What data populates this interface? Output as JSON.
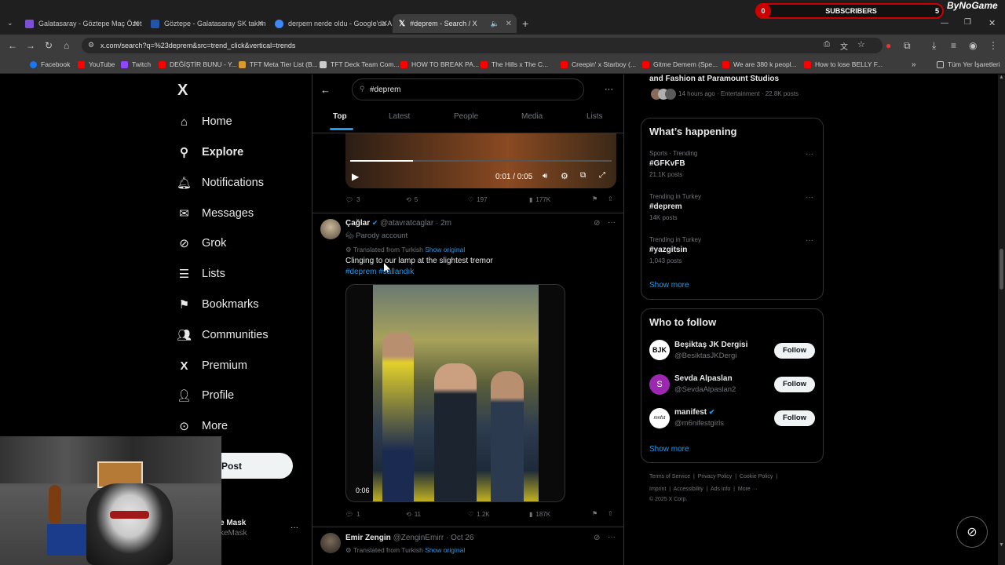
{
  "browser": {
    "tabs": [
      {
        "label": "Galatasaray - Göztepe Maç Özet",
        "favicon_color": "#7b4fd6"
      },
      {
        "label": "Göztepe - Galatasaray SK takım",
        "favicon_color": "#2255aa"
      },
      {
        "label": "derpem nerde oldu - Google'da A",
        "favicon_color": "#4285f4"
      },
      {
        "label": "#deprem - Search / X",
        "favicon_color": "#ffffff"
      }
    ],
    "url": "x.com/search?q=%23deprem&src=trend_click&vertical=trends",
    "bookmarks": [
      {
        "label": "Facebook",
        "color": "#1877f2"
      },
      {
        "label": "YouTube",
        "color": "#ff0000"
      },
      {
        "label": "Twitch",
        "color": "#9146ff"
      },
      {
        "label": "DEĞİŞTİR BUNU - Y...",
        "color": "#ff0000"
      },
      {
        "label": "TFT Meta Tier List (B...",
        "color": "#d89a2a"
      },
      {
        "label": "TFT Deck Team Com...",
        "color": "#cccccc"
      },
      {
        "label": "HOW TO BREAK PA...",
        "color": "#ff0000"
      },
      {
        "label": "The Hills x The C...",
        "color": "#ff0000"
      },
      {
        "label": "Creepin' x Starboy (...",
        "color": "#ff0000"
      },
      {
        "label": "Gitme Demem (Spe...",
        "color": "#ff0000"
      },
      {
        "label": "We are 380 k peopl...",
        "color": "#ff0000"
      },
      {
        "label": "How to lose BELLY F...",
        "color": "#ff0000"
      },
      {
        "label": "Tüm Yer İşaretleri",
        "color": "#c4c7c5"
      }
    ]
  },
  "overlay": {
    "subscriber_count": "0",
    "subscribers_label": "SUBSCRIBERS",
    "goal": "5",
    "brand": "ByNoGame"
  },
  "nav": {
    "logo": "X",
    "items": [
      "Home",
      "Explore",
      "Notifications",
      "Messages",
      "Grok",
      "Lists",
      "Bookmarks",
      "Communities",
      "Premium",
      "Profile",
      "More"
    ],
    "post_label": "Post",
    "account_name_fragment": "e Mask",
    "account_handle_fragment": "keMask",
    "account_more": "···"
  },
  "search": {
    "query": "#deprem",
    "tabs": [
      "Top",
      "Latest",
      "People",
      "Media",
      "Lists"
    ],
    "more": "···"
  },
  "tweet1": {
    "video_time": "0:01 / 0:05",
    "replies": "3",
    "reposts": "5",
    "likes": "197",
    "views": "177K"
  },
  "tweet2": {
    "name": "Çağlar",
    "handle": "@atavratcaglar",
    "time": "· 2m",
    "parody": "Parody account",
    "translated": "Translated from Turkish",
    "show_original": "Show original",
    "text": "Clinging to our lamp at the slightest tremor",
    "hashtags": "#deprem #sallandık",
    "video_time": "0:06",
    "replies": "1",
    "reposts": "11",
    "likes": "1.2K",
    "views": "187K"
  },
  "tweet3": {
    "name": "Emir Zengin",
    "handle": "@ZenginEmirr",
    "time": "· Oct 26",
    "translated": "Translated from Turkish",
    "show_original": "Show original"
  },
  "right": {
    "top_item_title": "and Fashion at Paramount Studios",
    "top_item_meta": "14 hours ago · Entertainment · 22.8K posts",
    "happening_title": "What’s happening",
    "trends": [
      {
        "category": "Sports · Trending",
        "name": "#GFKvFB",
        "count": "21.1K posts"
      },
      {
        "category": "Trending in Turkey",
        "name": "#deprem",
        "count": "14K posts"
      },
      {
        "category": "Trending in Turkey",
        "name": "#yazgitsin",
        "count": "1,043 posts"
      }
    ],
    "show_more": "Show more",
    "who_title": "Who to follow",
    "who": [
      {
        "name": "Beşiktaş JK Dergisi",
        "handle": "@BesiktasJKDergi",
        "follow": "Follow"
      },
      {
        "name": "Sevda Alpaslan",
        "handle": "@SevdaAlpaslan2",
        "follow": "Follow"
      },
      {
        "name": "manifest",
        "handle": "@m6nifestgirls",
        "follow": "Follow"
      }
    ],
    "footer": {
      "line1": [
        "Terms of Service",
        "Privacy Policy",
        "Cookie Policy"
      ],
      "line2": [
        "Imprint",
        "Accessibility",
        "Ads info",
        "More ···"
      ],
      "copyright": "© 2025 X Corp."
    }
  }
}
